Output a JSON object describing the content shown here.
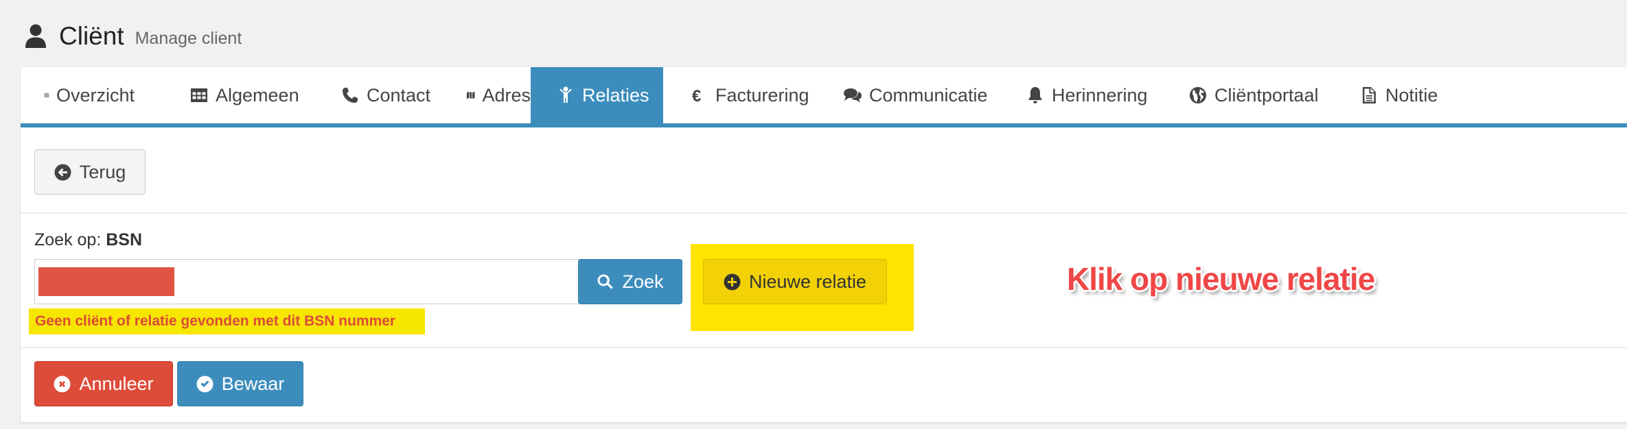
{
  "header": {
    "title": "Cliënt",
    "subtitle": "Manage client",
    "icon": "user-icon"
  },
  "tabs": [
    {
      "label": "Overzicht",
      "icon": "bars-icon",
      "active": false
    },
    {
      "label": "Algemeen",
      "icon": "table-icon",
      "active": false
    },
    {
      "label": "Contact",
      "icon": "phone-icon",
      "active": false
    },
    {
      "label": "Adres",
      "icon": "map-icon",
      "active": false
    },
    {
      "label": "Relaties",
      "icon": "child-icon",
      "active": true
    },
    {
      "label": "Facturering",
      "icon": "euro-icon",
      "active": false
    },
    {
      "label": "Communicatie",
      "icon": "comments-icon",
      "active": false
    },
    {
      "label": "Herinnering",
      "icon": "bell-icon",
      "active": false
    },
    {
      "label": "Cliëntportaal",
      "icon": "globe-icon",
      "active": false
    },
    {
      "label": "Notitie",
      "icon": "file-text-icon",
      "active": false
    }
  ],
  "back_button": {
    "label": "Terug",
    "icon": "arrow-circle-left-icon"
  },
  "search": {
    "label_prefix": "Zoek op:",
    "label_field": "BSN",
    "value": "",
    "button_label": "Zoek",
    "button_icon": "search-icon",
    "error": "Geen cliënt of relatie gevonden met dit BSN nummer"
  },
  "new_relation_button": {
    "label": "Nieuwe relatie",
    "icon": "plus-circle-icon"
  },
  "annotation": "Klik op nieuwe relatie",
  "footer": {
    "cancel_label": "Annuleer",
    "cancel_icon": "times-circle-icon",
    "save_label": "Bewaar",
    "save_icon": "check-circle-icon"
  },
  "colors": {
    "primary": "#3c8dbc",
    "danger": "#dd4b39",
    "highlight": "#ffe400",
    "warning_button": "#f2d207"
  }
}
